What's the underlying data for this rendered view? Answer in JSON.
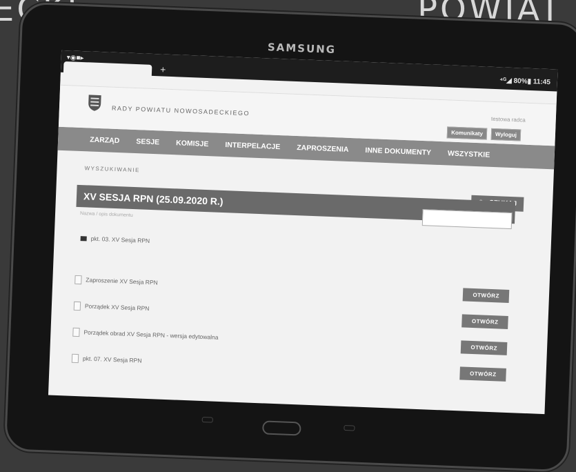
{
  "background": {
    "text_left": "ECKI",
    "text_right": "POWIAT N"
  },
  "device": {
    "brand": "SAMSUNG"
  },
  "status_bar": {
    "left_icons": "▾◉■▸",
    "right_text": "⁴ᴳ◢ 80%▮ 11:45"
  },
  "browser": {
    "new_tab_symbol": "+"
  },
  "header": {
    "org_name": "RADY POWIATU NOWOSADECKIEGO",
    "user_link": "testowa radca",
    "buttons": [
      "Komunikaty",
      "Wyloguj"
    ]
  },
  "nav": {
    "items": [
      "ZARZĄD",
      "SESJE",
      "KOMISJE",
      "INTERPELACJE",
      "ZAPROSZENIA",
      "INNE DOKUMENTY",
      "WSZYSTKIE"
    ]
  },
  "main": {
    "search_label": "WYSZUKIWANIE",
    "search_button": "SZUKAJ",
    "title": "XV SESJA RPN (25.09.2020 R.)",
    "search_placeholder": "Nazwa / opis dokumentu",
    "folder": "pkt. 03. XV Sesja RPN",
    "documents": [
      {
        "name": "Zaproszenie  XV Sesja RPN",
        "button": "OTWÓRZ"
      },
      {
        "name": "Porządek  XV Sesja RPN",
        "button": "OTWÓRZ"
      },
      {
        "name": "Porządek obrad  XV Sesja RPN - wersja edytowalna",
        "button": "OTWÓRZ"
      },
      {
        "name": "pkt. 07. XV Sesja RPN",
        "button": "OTWÓRZ"
      }
    ]
  },
  "colors": {
    "nav_bar": "#8a8a8a",
    "title_bar": "#6a6a6a",
    "tablet_body": "#141414"
  }
}
